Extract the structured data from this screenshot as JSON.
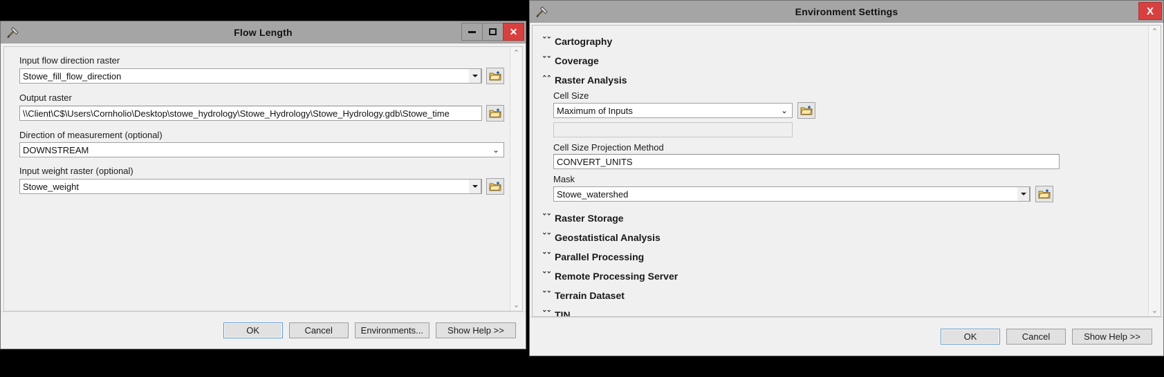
{
  "flow_length": {
    "title": "Flow Length",
    "icon": "hammer-tool-icon",
    "window_buttons": {
      "minimize": "–",
      "maximize": "□",
      "close": "✕"
    },
    "fields": [
      {
        "label": "Input flow direction raster",
        "value": "Stowe_fill_flow_direction",
        "type": "combo-browse"
      },
      {
        "label": "Output raster",
        "value": "\\\\Client\\C$\\Users\\Cornholio\\Desktop\\stowe_hydrology\\Stowe_Hydrology\\Stowe_Hydrology.gdb\\Stowe_time",
        "type": "text-browse"
      },
      {
        "label": "Direction of measurement (optional)",
        "value": "DOWNSTREAM",
        "type": "combo-thin"
      },
      {
        "label": "Input weight raster (optional)",
        "value": "Stowe_weight",
        "type": "combo-browse"
      }
    ],
    "buttons": {
      "ok": "OK",
      "cancel": "Cancel",
      "environments": "Environments...",
      "show_help": "Show Help >>"
    },
    "scroll": {
      "up": "⌃",
      "down": "⌄"
    }
  },
  "environment_settings": {
    "title": "Environment Settings",
    "icon": "hammer-tool-icon",
    "close_label": "X",
    "chevron_collapsed": "ˇˇ",
    "chevron_expanded": "ˆˆ",
    "sections": [
      {
        "label": "Cartography",
        "expanded": false
      },
      {
        "label": "Coverage",
        "expanded": false
      },
      {
        "label": "Raster Analysis",
        "expanded": true
      },
      {
        "label": "Raster Storage",
        "expanded": false
      },
      {
        "label": "Geostatistical Analysis",
        "expanded": false
      },
      {
        "label": "Parallel Processing",
        "expanded": false
      },
      {
        "label": "Remote Processing Server",
        "expanded": false
      },
      {
        "label": "Terrain Dataset",
        "expanded": false
      },
      {
        "label": "TIN",
        "expanded": false
      }
    ],
    "raster_analysis": {
      "cell_size_label": "Cell Size",
      "cell_size_value": "Maximum of Inputs",
      "cell_size_custom_value": "",
      "projection_method_label": "Cell Size Projection Method",
      "projection_method_value": "CONVERT_UNITS",
      "mask_label": "Mask",
      "mask_value": "Stowe_watershed"
    },
    "buttons": {
      "ok": "OK",
      "cancel": "Cancel",
      "show_help": "Show Help >>"
    },
    "scroll": {
      "up": "⌃",
      "down": "⌄"
    }
  },
  "colors": {
    "titlebar": "#a5a5a5",
    "dialog_bg": "#f0f0f0",
    "close_red": "#d84040",
    "focus_blue": "#5a9bd5",
    "desktop": "#000000"
  }
}
